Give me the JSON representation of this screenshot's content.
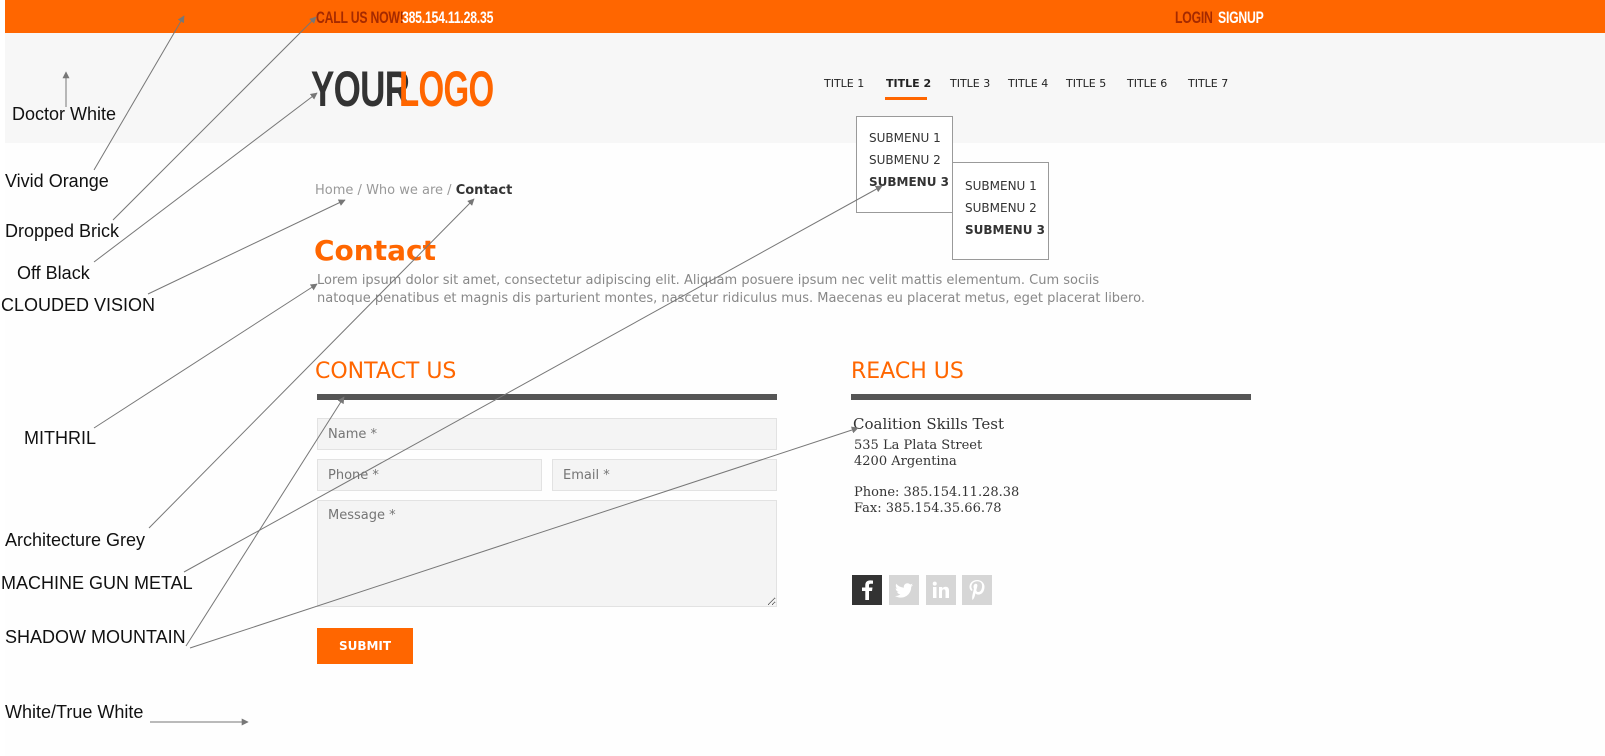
{
  "topbar": {
    "call_label": "CALL US NOW!",
    "phone": "385.154.11.28.35",
    "login": "LOGIN",
    "signup": "SIGNUP",
    "color": "#ff6600"
  },
  "logo": {
    "part1": "YOUR",
    "part2": "LOGO"
  },
  "nav": {
    "items": [
      "TITLE 1",
      "TITLE 2",
      "TITLE 3",
      "TITLE 4",
      "TITLE 5",
      "TITLE 6",
      "TITLE 7"
    ],
    "active": "TITLE 2"
  },
  "submenu": [
    "SUBMENU 1",
    "SUBMENU 2",
    "SUBMENU 3"
  ],
  "submenu2": [
    "SUBMENU 1",
    "SUBMENU 2",
    "SUBMENU 3"
  ],
  "breadcrumb": {
    "home": "Home",
    "sep": "/",
    "parent": "Who we are",
    "current": "Contact"
  },
  "page": {
    "title": "Contact",
    "intro": "Lorem ipsum dolor sit amet, consectetur adipiscing elit. Aliquam posuere ipsum nec velit mattis elementum. Cum sociis natoque penatibus et magnis dis parturient montes, nascetur ridiculus mus. Maecenas eu placerat metus, eget placerat libero."
  },
  "contact": {
    "heading": "CONTACT US",
    "name_placeholder": "Name *",
    "phone_placeholder": "Phone *",
    "email_placeholder": "Email *",
    "message_placeholder": "Message *",
    "submit": "SUBMIT"
  },
  "reach": {
    "heading": "REACH US",
    "company": "Coalition Skills Test",
    "street": "535 La Plata Street",
    "city": "4200 Argentina",
    "phone": "Phone: 385.154.11.28.38",
    "fax": "Fax: 385.154.35.66.78",
    "social": [
      "facebook-icon",
      "twitter-icon",
      "linkedin-icon",
      "pinterest-icon"
    ]
  },
  "annotations": {
    "doctor_white": "Doctor White",
    "vivid_orange": "Vivid Orange",
    "dropped_brick": "Dropped Brick",
    "off_black": "Off Black",
    "clouded_vision": "CLOUDED VISION",
    "mithril": "MITHRIL",
    "architecture_grey": "Architecture Grey",
    "machine_gun_metal": "MACHINE GUN METAL",
    "shadow_mountain": "SHADOW MOUNTAIN",
    "white_true_white": "White/True White"
  },
  "colors": {
    "orange": "#ff6600",
    "off_black": "#333333",
    "doctor_white": "#f7f7f7",
    "gun_metal": "#555555"
  }
}
